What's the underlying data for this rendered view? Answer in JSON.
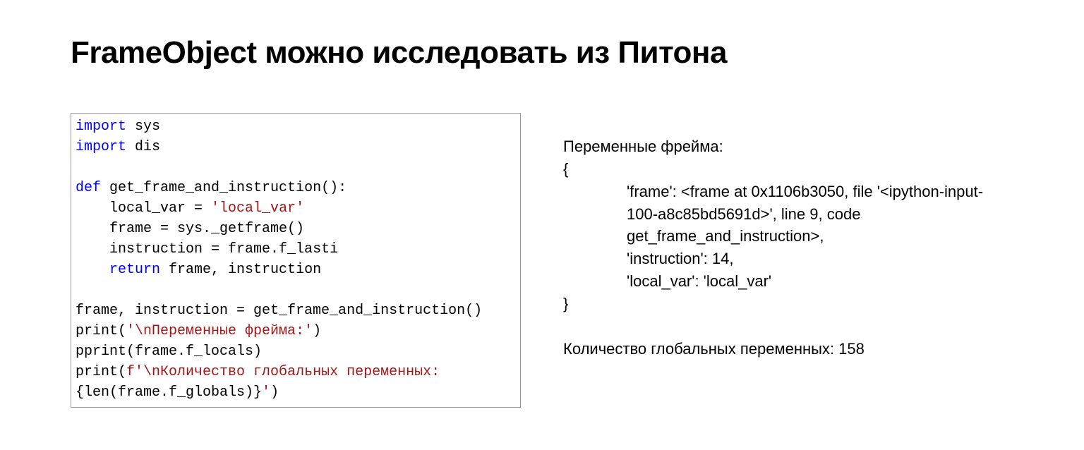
{
  "title": "FrameObject можно исследовать из Питона",
  "code": {
    "kw_import1": "import",
    "mod_sys": " sys",
    "kw_import2": "import",
    "mod_dis": " dis",
    "kw_def": "def",
    "def_rest": " get_frame_and_instruction():",
    "line_local_pre": "    local_var = ",
    "line_local_str": "'local_var'",
    "line_frame": "    frame = sys._getframe()",
    "line_instr": "    instruction = frame.f_lasti",
    "ret_indent": "    ",
    "kw_return": "return",
    "ret_rest": " frame, instruction",
    "call_line": "frame, instruction = get_frame_and_instruction()",
    "print1_pre": "print(",
    "print1_str": "'\\nПеременные фрейма:'",
    "print1_post": ")",
    "pprint_line": "pprint(frame.f_locals)",
    "print2_pre": "print(",
    "print2_fpre": "f'\\n",
    "print2_red": "Количество глобальных переменных: ",
    "print2_expr": "{len(frame.f_globals)}",
    "print2_strclose": "'",
    "print2_post": ")"
  },
  "output": {
    "header": "Переменные фрейма:",
    "brace_open": "{",
    "frame_line": "'frame': <frame at 0x1106b3050, file '<ipython-input-100-a8c85bd5691d>', line 9, code get_frame_and_instruction>,",
    "instr_line": "'instruction': 14,",
    "localvar_line": "'local_var': 'local_var'",
    "brace_close": "}",
    "globals_line": "Количество глобальных переменных: 158"
  }
}
